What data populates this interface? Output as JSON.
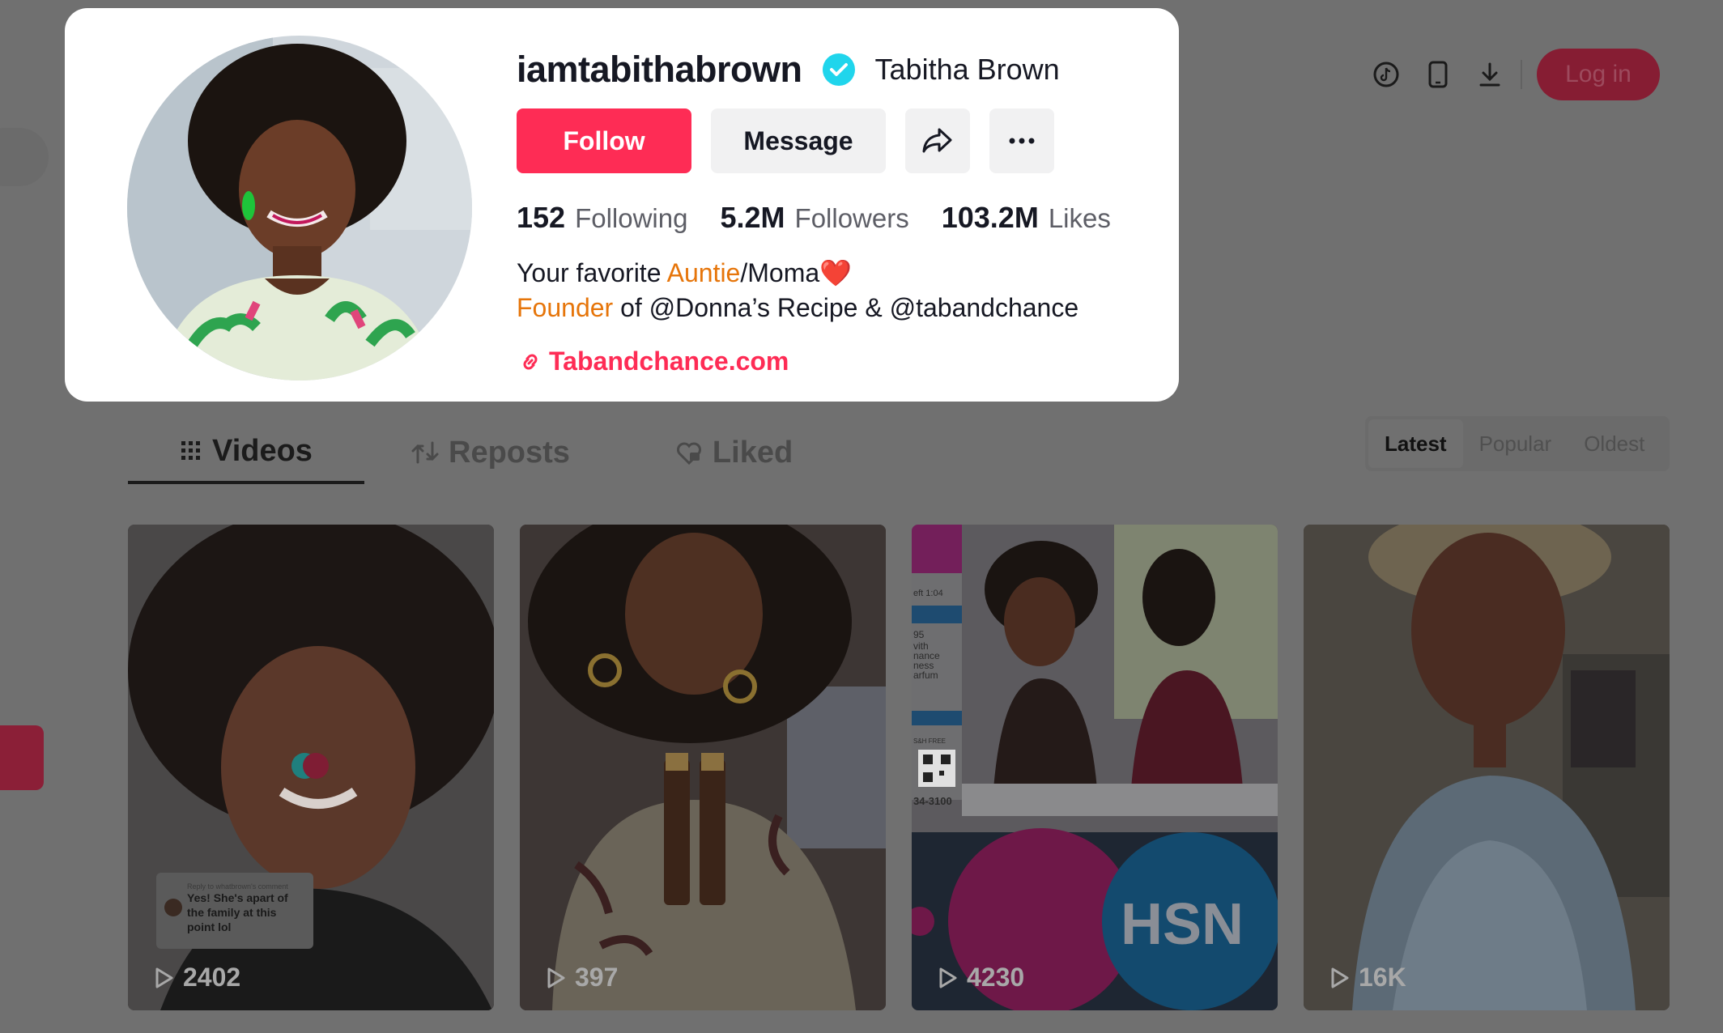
{
  "header": {
    "icons": [
      "tiktok-coin-icon",
      "phone-icon",
      "download-icon"
    ],
    "login_label": "Log in"
  },
  "profile": {
    "username": "iamtabithabrown",
    "nickname": "Tabitha Brown",
    "verified": true,
    "follow_label": "Follow",
    "message_label": "Message",
    "stats": {
      "following_count": "152",
      "following_label": "Following",
      "followers_count": "5.2M",
      "followers_label": "Followers",
      "likes_count": "103.2M",
      "likes_label": "Likes"
    },
    "bio": {
      "line1_pre": "Your favorite ",
      "line1_hl": "Auntie",
      "line1_post": "/Moma",
      "line1_emoji": "❤️",
      "line2_hl": "Founder",
      "line2_post": " of @Donna’s Recipe & @tabandchance"
    },
    "link": "Tabandchance.com"
  },
  "tabs": [
    {
      "label": "Videos",
      "active": true
    },
    {
      "label": "Reposts",
      "active": false
    },
    {
      "label": "Liked",
      "active": false
    }
  ],
  "sort": {
    "options": [
      "Latest",
      "Popular",
      "Oldest"
    ],
    "selected": "Latest"
  },
  "videos": [
    {
      "views": "2402",
      "overlay": {
        "small": "Reply to whatbrown's comment",
        "text": "Yes! She's apart of the family at this point lol"
      }
    },
    {
      "views": "397"
    },
    {
      "views": "4230",
      "overlay_text": {
        "time": "eft 1:04",
        "lines": [
          "95",
          "vith",
          "nance",
          "ness",
          "arfum"
        ],
        "free": "S&H FREE",
        "phone": "34-3100",
        "logo": "HSN"
      }
    },
    {
      "views": "16K"
    }
  ],
  "colors": {
    "accent": "#fe2c55",
    "highlight": "#e6750a",
    "verified": "#20d5ec"
  }
}
